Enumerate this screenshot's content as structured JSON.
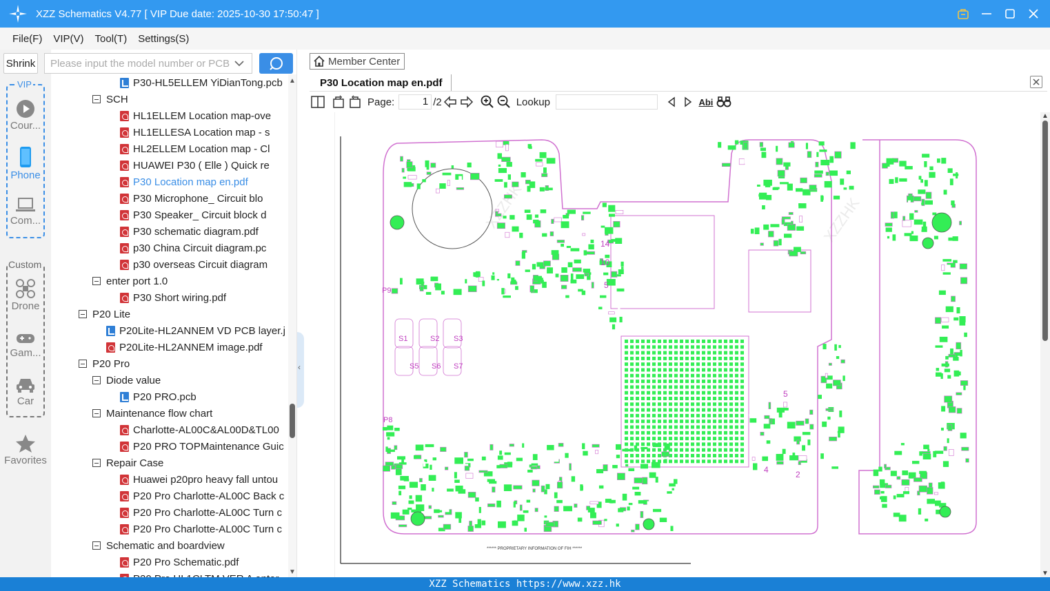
{
  "window": {
    "title": "XZZ Schematics V4.77 [ VIP Due date: 2025-10-30 17:50:47 ]"
  },
  "menu": [
    "File(F)",
    "VIP(V)",
    "Tool(T)",
    "Settings(S)"
  ],
  "search": {
    "shrink_label": "Shrink",
    "placeholder": "Please input the model number or PCB"
  },
  "sidebar": {
    "vip_label": "VIP",
    "custom_label": "Custom",
    "items": [
      {
        "label": "Cour...",
        "icon": "play-circle-icon"
      },
      {
        "label": "Phone",
        "icon": "phone-icon"
      },
      {
        "label": "Com...",
        "icon": "laptop-icon"
      },
      {
        "label": "Drone",
        "icon": "drone-icon"
      },
      {
        "label": "Gam...",
        "icon": "gamepad-icon"
      },
      {
        "label": "Car",
        "icon": "car-icon"
      },
      {
        "label": "Favorites",
        "icon": "star-icon"
      }
    ]
  },
  "tree": [
    {
      "label": "P30-HL5ELLEM YiDianTong.pcb",
      "type": "pcb",
      "level": 3
    },
    {
      "label": "SCH",
      "type": "folder",
      "level": 2
    },
    {
      "label": "HL1ELLEM Location map-ove",
      "type": "pdf",
      "level": 3
    },
    {
      "label": "HL1ELLESA Location map - s",
      "type": "pdf",
      "level": 3
    },
    {
      "label": "HL2ELLEM Location map - Cl",
      "type": "pdf",
      "level": 3
    },
    {
      "label": "HUAWEI P30 ( Elle ) Quick re",
      "type": "pdf",
      "level": 3
    },
    {
      "label": "P30 Location map en.pdf",
      "type": "pdf",
      "level": 3,
      "selected": true
    },
    {
      "label": "P30 Microphone_ Circuit blo",
      "type": "pdf",
      "level": 3
    },
    {
      "label": "P30 Speaker_ Circuit block d",
      "type": "pdf",
      "level": 3
    },
    {
      "label": "P30 schematic diagram.pdf",
      "type": "pdf",
      "level": 3
    },
    {
      "label": "p30 China Circuit diagram.pc",
      "type": "pdf",
      "level": 3
    },
    {
      "label": "p30 overseas Circuit diagram",
      "type": "pdf",
      "level": 3
    },
    {
      "label": "enter port 1.0",
      "type": "folder",
      "level": 2
    },
    {
      "label": "P30 Short wiring.pdf",
      "type": "pdf",
      "level": 3
    },
    {
      "label": "P20 Lite",
      "type": "folder",
      "level": 1
    },
    {
      "label": "P20Lite-HL2ANNEM VD PCB layer.j",
      "type": "pcb",
      "level": 2
    },
    {
      "label": "P20Lite-HL2ANNEM image.pdf",
      "type": "pdf",
      "level": 2
    },
    {
      "label": "P20 Pro",
      "type": "folder",
      "level": 1
    },
    {
      "label": "Diode value",
      "type": "folder",
      "level": 2
    },
    {
      "label": "P20 PRO.pcb",
      "type": "pcb",
      "level": 3
    },
    {
      "label": "Maintenance flow chart",
      "type": "folder",
      "level": 2
    },
    {
      "label": "Charlotte-AL00C&AL00D&TL00",
      "type": "pdf",
      "level": 3
    },
    {
      "label": "P20 PRO TOPMaintenance Guic",
      "type": "pdf",
      "level": 3
    },
    {
      "label": "Repair Case",
      "type": "folder",
      "level": 2
    },
    {
      "label": "Huawei p20pro heavy fall untou",
      "type": "pdf",
      "level": 3
    },
    {
      "label": "P20 Pro Charlotte-AL00C Back c",
      "type": "pdf",
      "level": 3
    },
    {
      "label": "P20 Pro Charlotte-AL00C Turn c",
      "type": "pdf",
      "level": 3
    },
    {
      "label": "P20 Pro Charlotte-AL00C Turn c",
      "type": "pdf",
      "level": 3
    },
    {
      "label": "Schematic and boardview",
      "type": "folder",
      "level": 2
    },
    {
      "label": "P20 Pro Schematic.pdf",
      "type": "pdf",
      "level": 3
    },
    {
      "label": "P20 Pro HL1CLTM VER A enter",
      "type": "pdf",
      "level": 3
    }
  ],
  "viewer": {
    "member_center": "Member Center",
    "tab_title": "P30 Location map en.pdf",
    "page_label": "Page:",
    "page_current": "1",
    "page_total": "/2",
    "lookup_label": "Lookup",
    "abi_label": "Abi"
  },
  "document": {
    "footer_text": "****** PROPRIETARY INFORMATION OF FIH ******",
    "side_labels": [
      "P9",
      "P8",
      "14",
      "10",
      "5",
      "5",
      "4",
      "2"
    ],
    "connector_labels": [
      "S1",
      "S2",
      "S3",
      "S5",
      "S6",
      "S7"
    ],
    "watermark": "XZZHK"
  },
  "status": {
    "text": "XZZ Schematics https://www.xzz.hk"
  },
  "colors": {
    "titlebar": "#3399f0",
    "accent": "#3a8ee6",
    "status": "#1a80d6",
    "pcb_component": "#33ee55",
    "pcb_outline": "#d070d0"
  }
}
